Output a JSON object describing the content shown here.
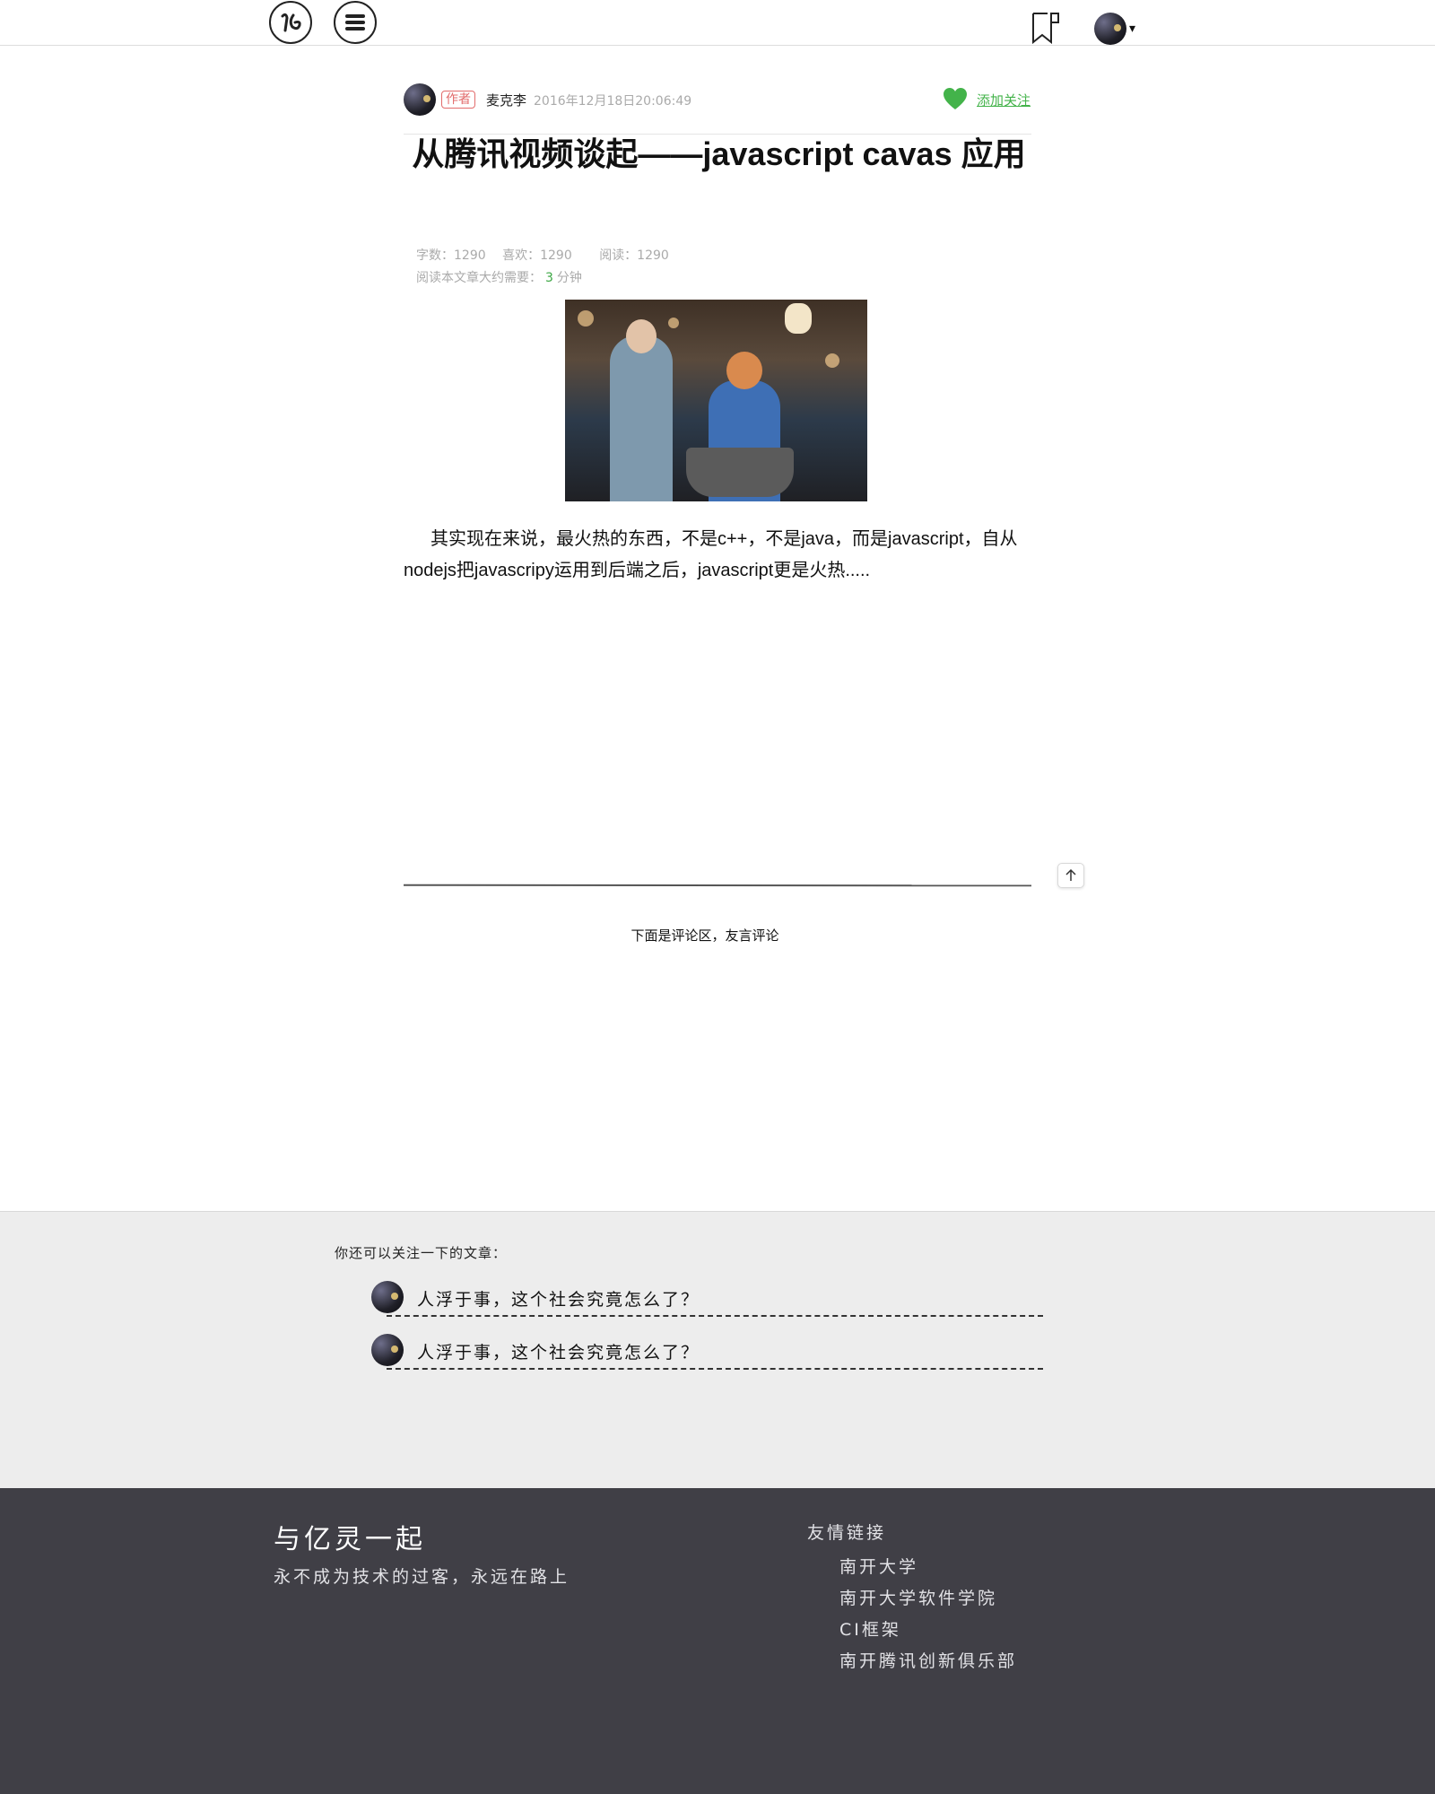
{
  "header": {
    "logo_icon": "logo-icon",
    "menu_icon": "hamburger-menu-icon",
    "bookmark_icon": "bookmark-icon",
    "avatar_icon": "user-avatar",
    "dropdown_glyph": "▾"
  },
  "author": {
    "badge": "作者",
    "name": "麦克李",
    "date": "2016年12月18日20:06:49",
    "follow_label": "添加关注",
    "follow_color": "#43b34a"
  },
  "article": {
    "title": "从腾讯视频谈起——javascript cavas 应用",
    "stats": {
      "words": "字数：1290",
      "likes": "喜欢：1290",
      "reads": "阅读：1290"
    },
    "read_time_prefix": "阅读本文章大约需要：",
    "read_time_value": "3",
    "read_time_unit": "分钟",
    "body": "其实现在来说，最火热的东西，不是c++，不是java，而是javascript，自从nodejs把javascripy运用到后端之后，javascript更是火热....."
  },
  "comments": {
    "note": "下面是评论区，友言评论"
  },
  "related": {
    "heading": "你还可以关注一下的文章：",
    "items": [
      {
        "title": "人浮于事，这个社会究竟怎么了？"
      },
      {
        "title": "人浮于事，这个社会究竟怎么了？"
      }
    ]
  },
  "footer": {
    "title": "与亿灵一起",
    "subtitle": "永不成为技术的过客，永远在路上",
    "links_heading": "友情链接",
    "links": [
      "南开大学",
      "南开大学软件学院",
      "CI框架",
      "南开腾讯创新俱乐部"
    ]
  },
  "colors": {
    "accent_green": "#43b34a",
    "author_badge_red": "#e26c6c",
    "related_bg": "#ededed",
    "footer_bg": "#403f46"
  }
}
